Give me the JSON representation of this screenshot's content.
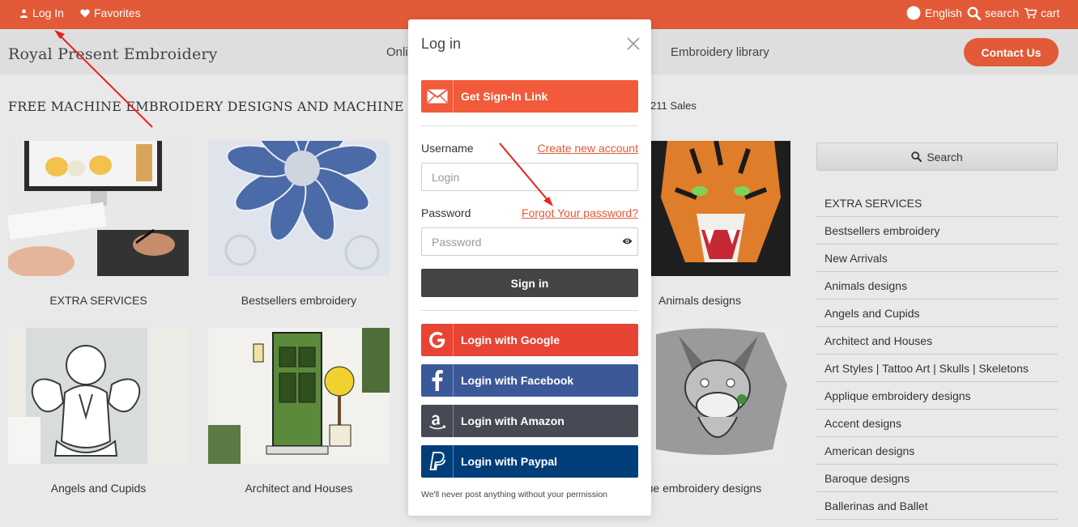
{
  "topbar": {
    "login": "Log In",
    "favorites": "Favorites",
    "language": "English",
    "search": "search",
    "cart": "cart"
  },
  "header": {
    "brand": "Royal Present Embroidery",
    "nav_partial": "Onli",
    "nav_library": "Embroidery library",
    "contact": "Contact Us"
  },
  "main": {
    "heading": "FREE MACHINE EMBROIDERY DESIGNS AND MACHINE EM",
    "sales": "211 Sales",
    "cards": [
      {
        "label": "EXTRA SERVICES"
      },
      {
        "label": "Bestsellers embroidery"
      },
      {
        "label": "Animals designs"
      },
      {
        "label": "Angels and Cupids"
      },
      {
        "label": "Architect and Houses"
      },
      {
        "label": "ique embroidery designs"
      }
    ]
  },
  "sidebar": {
    "search_label": "Search",
    "items": [
      {
        "label": "EXTRA SERVICES"
      },
      {
        "label": "Bestsellers embroidery"
      },
      {
        "label": "New Arrivals"
      },
      {
        "label": "Animals designs"
      },
      {
        "label": "Angels and Cupids"
      },
      {
        "label": "Architect and Houses"
      },
      {
        "label": "Art Styles | Tattoo Art | Skulls | Skeletons"
      },
      {
        "label": "Applique embroidery designs"
      },
      {
        "label": "Accent designs"
      },
      {
        "label": "American designs"
      },
      {
        "label": "Baroque designs"
      },
      {
        "label": "Ballerinas and Ballet"
      }
    ]
  },
  "modal": {
    "title": "Log in",
    "sign_in_link": "Get Sign-In Link",
    "username_label": "Username",
    "create_account": "Create new account",
    "login_placeholder": "Login",
    "password_label": "Password",
    "forgot": "Forgot Your password?",
    "password_placeholder": "Password",
    "sign_in": "Sign in",
    "google": "Login with Google",
    "facebook": "Login with Facebook",
    "amazon": "Login with Amazon",
    "paypal": "Login with Paypal",
    "note": "We'll never post anything without your permission"
  },
  "colors": {
    "accent": "#e25a37",
    "sign_in_link": "#f15a3a",
    "google": "#e84434",
    "facebook": "#3b5998",
    "amazon": "#454a54",
    "paypal": "#003e7a",
    "dark_button": "#444444",
    "annotation_arrow": "#e8231b"
  },
  "icons": [
    "user-icon",
    "heart-icon",
    "globe-icon",
    "search-icon",
    "cart-icon",
    "close-icon",
    "envelope-icon",
    "eye-icon",
    "google-icon",
    "facebook-icon",
    "amazon-icon",
    "paypal-icon"
  ]
}
